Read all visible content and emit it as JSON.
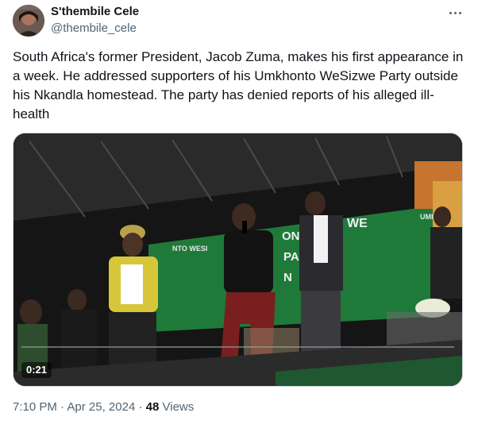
{
  "author": {
    "display_name": "S'thembile Cele",
    "handle": "@thembile_cele"
  },
  "icons": {
    "more": "more-horizontal-icon"
  },
  "tweet": {
    "text": "South Africa's former President, Jacob Zuma, makes his first appearance in a week. He addressed supporters of his Umkhonto WeSizwe Party outside his Nkandla homestead. The party has denied reports of his alleged ill-health"
  },
  "video": {
    "duration": "0:21",
    "banner_texts": [
      "WE",
      "ONT",
      "PA",
      "N",
      "UMKH",
      "NTO WESI",
      "M"
    ]
  },
  "meta": {
    "time": "7:10 PM",
    "separator": "·",
    "date": "Apr 25, 2024",
    "views_count": "48",
    "views_label": "Views"
  },
  "colors": {
    "text_primary": "#0f1419",
    "text_secondary": "#536471",
    "border": "#cfd9de",
    "banner_green": "#1f7a3a"
  }
}
